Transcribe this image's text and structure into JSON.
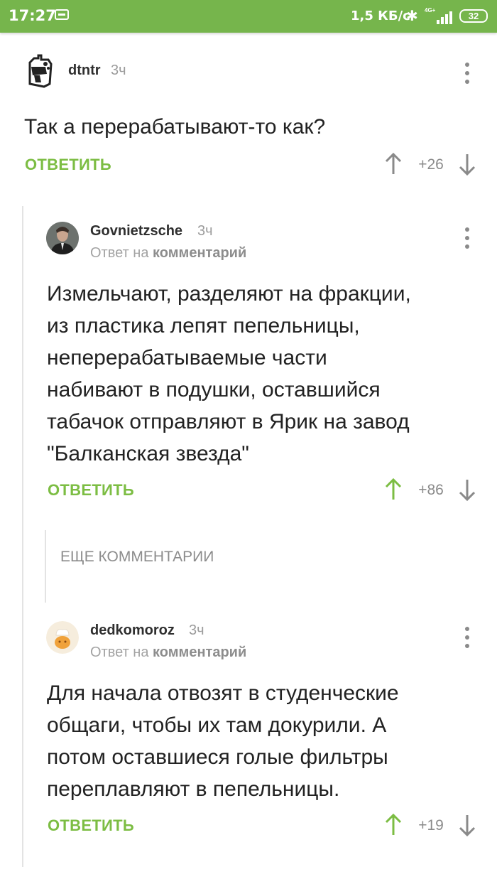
{
  "status_bar": {
    "time": "17:27",
    "network_speed": "1,5 КБ/с",
    "network_type": "4G+",
    "battery": "32",
    "icons": [
      "cast-icon",
      "bluetooth-icon",
      "signal-icon",
      "battery-icon"
    ]
  },
  "colors": {
    "status_bar": "#76b54c",
    "accent_green": "#7cbd43",
    "upvote_active": "#7cbd43",
    "neutral_gray": "#8a8a8a"
  },
  "comments": [
    {
      "username": "dtntr",
      "time": "3ч",
      "text": "Так а перерабатывают-то как?",
      "reply_label": "ОТВЕТИТЬ",
      "score": "+26",
      "upvoted": false
    },
    {
      "username": "Govnietzsche",
      "time": "3ч",
      "reply_to_prefix": "Ответ на",
      "reply_to_link": "комментарий",
      "text_lines": [
        "Измельчают, разделяют на фракции,",
        "из пластика лепят пепельницы,",
        "неперерабатываемые части",
        "набивают в подушки, оставшийся",
        "табачок отправляют в Ярик на завод",
        "\"Балканская звезда\""
      ],
      "reply_label": "ОТВЕТИТЬ",
      "score": "+86",
      "upvoted": true
    },
    {
      "username": "dedkomoroz",
      "time": "3ч",
      "reply_to_prefix": "Ответ на",
      "reply_to_link": "комментарий",
      "text_lines": [
        "Для начала отвозят в студенческие",
        "общаги, чтобы их там докурили. А",
        "потом оставшиеся голые фильтры",
        "переплавляют в пепельницы."
      ],
      "reply_label": "ОТВЕТИТЬ",
      "score": "+19",
      "upvoted": true
    }
  ],
  "more_comments_label": "ЕЩЕ КОММЕНТАРИИ"
}
